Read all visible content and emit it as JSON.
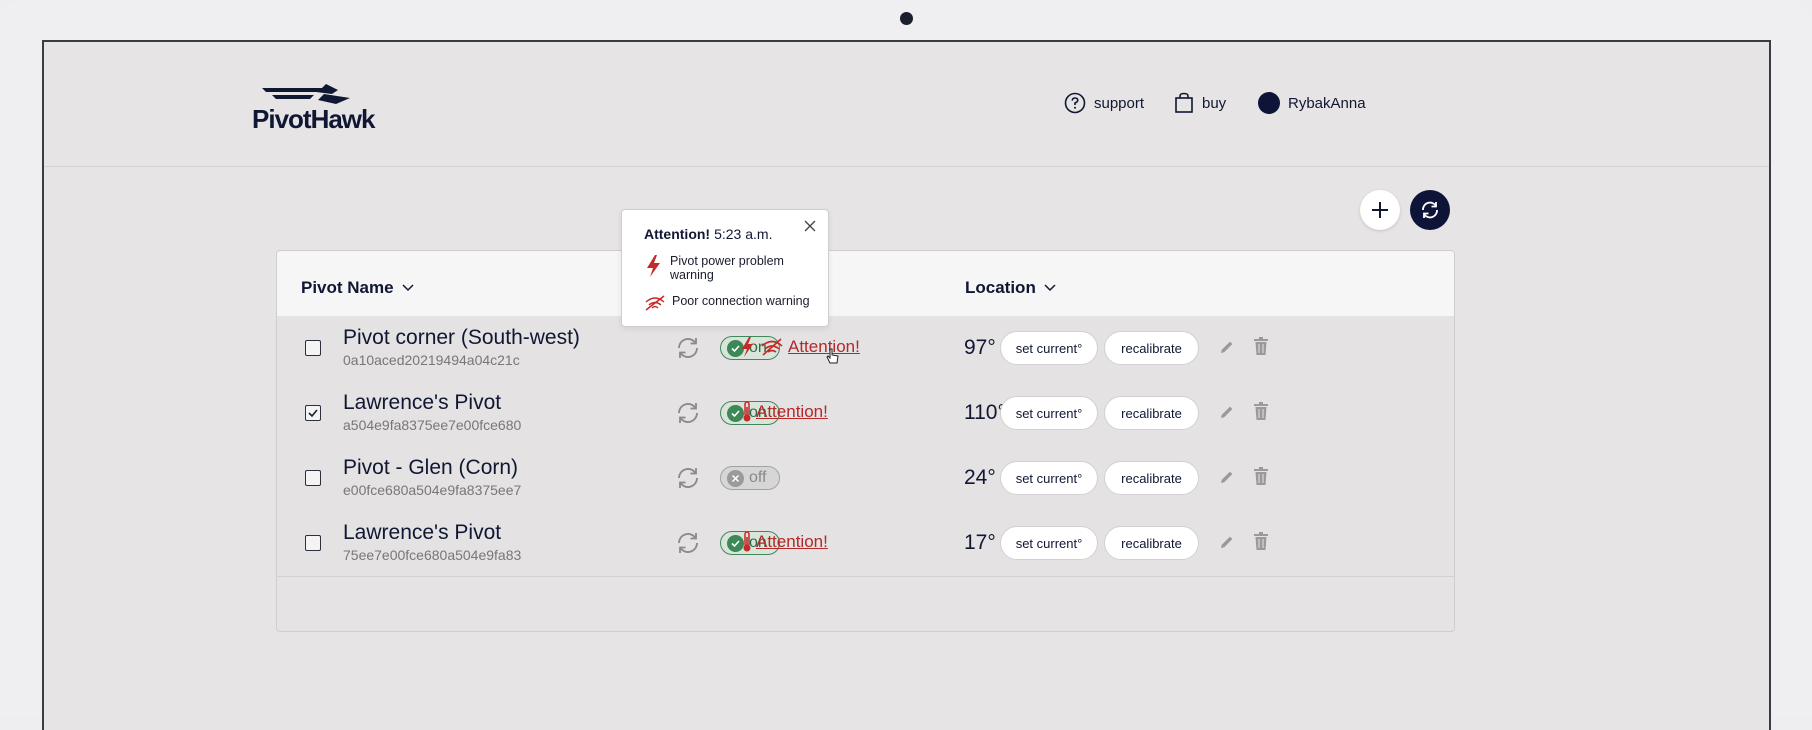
{
  "app": {
    "brand": "PivotHawk"
  },
  "nav": {
    "support_label": "support",
    "buy_label": "buy",
    "user_name": "RybakAnna"
  },
  "table": {
    "columns": {
      "name": "Pivot Name",
      "location": "Location"
    },
    "rows": [
      {
        "name": "Pivot corner (South-west)",
        "id": "0a10aced20219494a04c21c",
        "status": "on",
        "alerts": [
          "power",
          "connection"
        ],
        "attention": "Attention!",
        "degrees": "97°",
        "checked": false
      },
      {
        "name": "Lawrence's Pivot",
        "id": "a504e9fa8375ee7e00fce680",
        "status": "on",
        "alerts": [
          "temperature"
        ],
        "attention": "Attention!",
        "degrees": "110°",
        "checked": true
      },
      {
        "name": "Pivot - Glen (Corn)",
        "id": "e00fce680a504e9fa8375ee7",
        "status": "off",
        "alerts": [],
        "attention": "",
        "degrees": "24°",
        "checked": false
      },
      {
        "name": "Lawrence's Pivot",
        "id": "75ee7e00fce680a504e9fa83",
        "status": "on",
        "alerts": [
          "temperature"
        ],
        "attention": "Attention!",
        "degrees": "17°",
        "checked": false
      }
    ],
    "set_current_label": "set current°",
    "recalibrate_label": "recalibrate"
  },
  "popup": {
    "title": "Attention!",
    "time": "5:23 a.m.",
    "items": [
      {
        "icon": "power-warning-icon",
        "text": "Pivot power problem warning"
      },
      {
        "icon": "connection-warning-icon",
        "text": "Poor connection warning"
      }
    ]
  },
  "colors": {
    "brand_navy": "#0d1437",
    "alert_red": "#b42828",
    "on_green": "#3c8857"
  }
}
